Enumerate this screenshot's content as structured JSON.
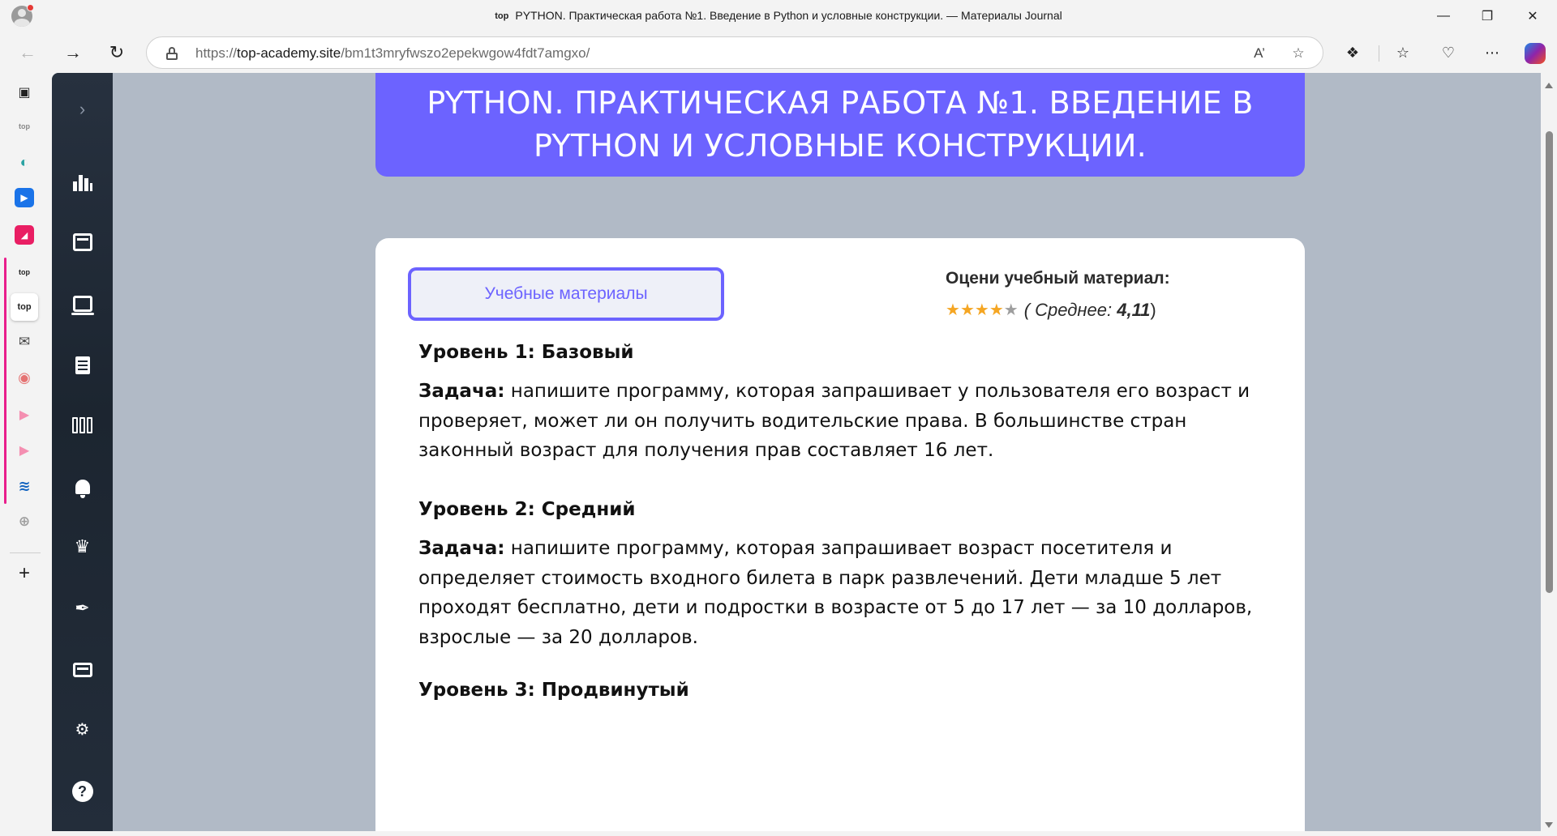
{
  "browser": {
    "window_title": "PYTHON. Практическая работа №1. Введение в Python и условные конструкции. — Материалы Journal",
    "title_favicon": "top",
    "url_prefix": "https://",
    "url_host": "top-academy.site",
    "url_path": "/bm1t3mryfwszo2epekwgow4fdt7amgxo/",
    "vertical_tabs": [
      {
        "icon": "tab-actions-icon"
      },
      {
        "icon": "top-logo",
        "label": "top"
      },
      {
        "icon": "edge-icon"
      },
      {
        "icon": "play-icon"
      },
      {
        "icon": "pink-app-icon"
      },
      {
        "icon": "top-logo",
        "label": "top"
      },
      {
        "icon": "top-logo",
        "label": "top",
        "active": true
      },
      {
        "icon": "mail-icon"
      },
      {
        "icon": "chrome-icon"
      },
      {
        "icon": "arrow-tag-icon"
      },
      {
        "icon": "arrow-tag-icon"
      },
      {
        "icon": "edge-wave-icon"
      },
      {
        "icon": "grey-app-icon"
      },
      {
        "icon": "new-tab-plus-icon",
        "label": "+"
      }
    ],
    "group_color": "#e91e8c"
  },
  "sidebar": {
    "items": [
      "expand-icon",
      "chart-icon",
      "calendar-icon",
      "laptop-icon",
      "homework-icon",
      "library-icon",
      "bell-icon",
      "trophy-icon",
      "feather-icon",
      "wallet-icon",
      "settings-gear-icon",
      "help-icon"
    ],
    "help_label": "?"
  },
  "page": {
    "header_title": "PYTHON. ПРАКТИЧЕСКАЯ РАБОТА №1. ВВЕДЕНИЕ В PYTHON И УСЛОВНЫЕ КОНСТРУКЦИИ.",
    "materials_button": "Учебные материалы",
    "rate_title": "Оцени учебный материал:",
    "rating": {
      "open": "(",
      "label": "Среднее:",
      "value": "4,11",
      "close": ")",
      "value_numeric": 4.11,
      "max_stars": 5
    },
    "levels": [
      {
        "title": "Уровень 1: Базовый",
        "task_label": "Задача:",
        "task_text": " напишите программу, которая запрашивает у пользователя его возраст и проверяет, может ли он получить водительские права. В большинстве стран законный возраст для получения прав составляет 16 лет."
      },
      {
        "title": "Уровень 2: Средний",
        "task_label": "Задача:",
        "task_text": " напишите программу, которая запрашивает возраст посетителя и определяет стоимость входного билета в парк развлечений. Дети младше 5 лет проходят бесплатно, дети и подростки в возрасте от 5 до 17 лет — за 10 долларов, взрослые — за 20 долларов."
      },
      {
        "title": "Уровень 3: Продвинутый"
      }
    ]
  },
  "colors": {
    "accent": "#6c63ff",
    "page_background": "#b1bac6",
    "sidebar": "#1f2833",
    "star": "#f5a623"
  }
}
